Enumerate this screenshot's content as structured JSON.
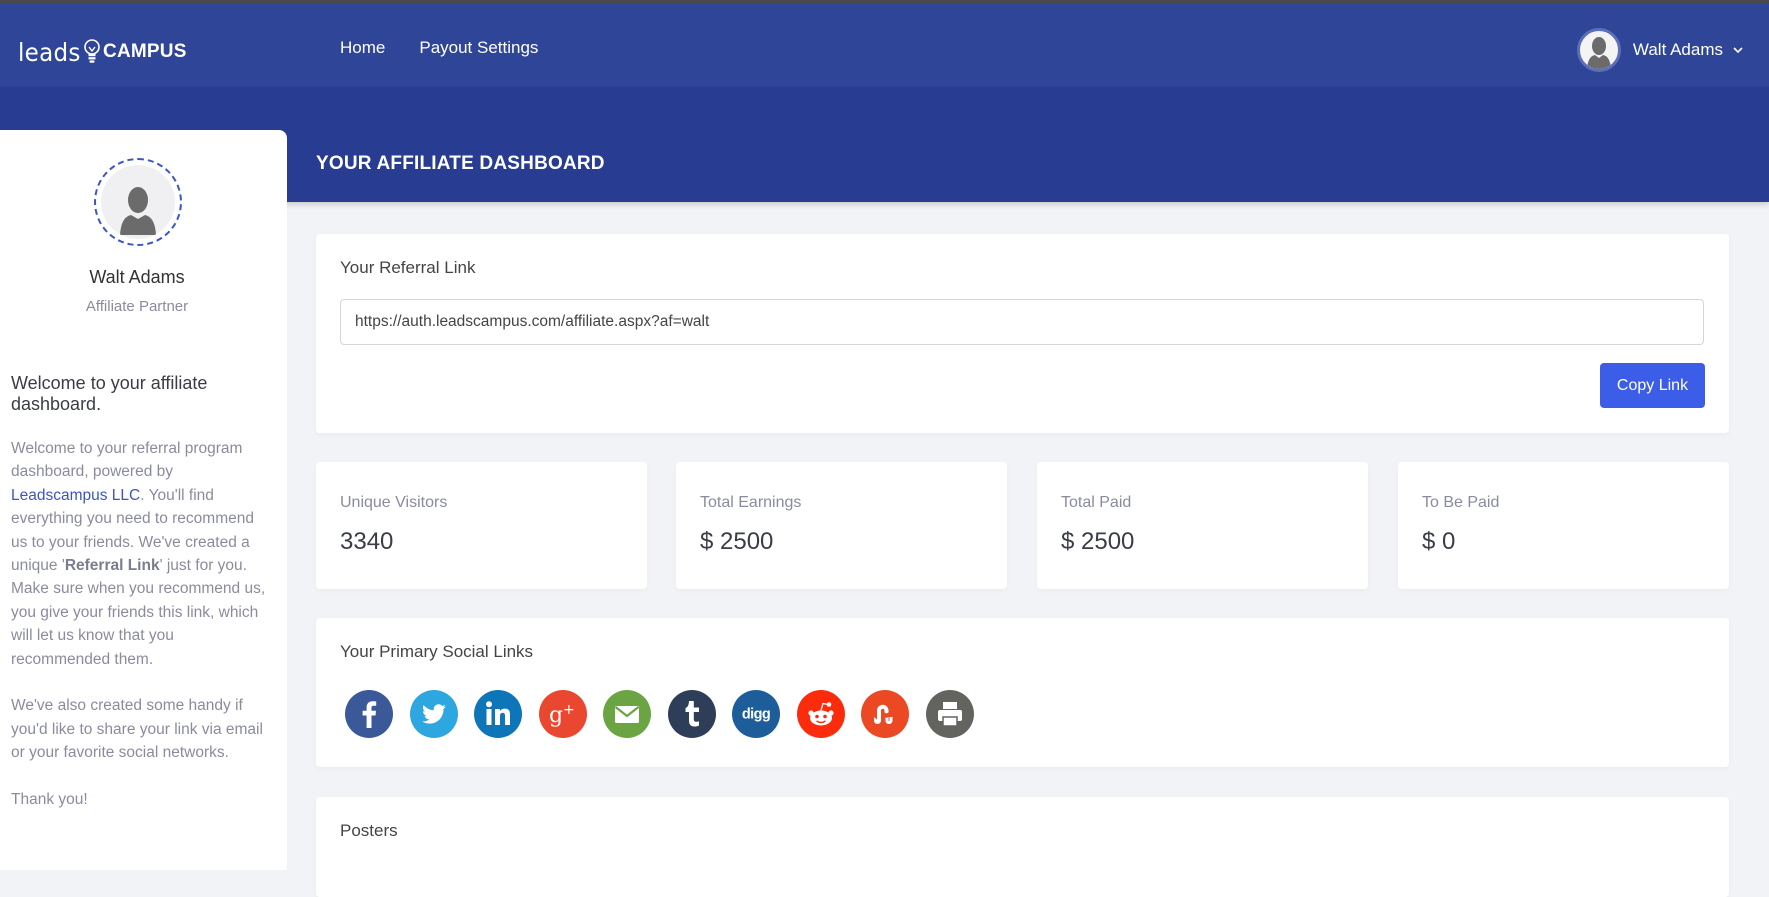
{
  "header": {
    "logo_leads": "leads",
    "logo_campus": "CAMPUS",
    "nav": [
      {
        "label": "Home"
      },
      {
        "label": "Payout Settings"
      }
    ],
    "user_name": "Walt Adams"
  },
  "banner": {
    "title": "YOUR AFFILIATE DASHBOARD"
  },
  "sidebar": {
    "name": "Walt Adams",
    "role": "Affiliate Partner",
    "welcome_heading": "Welcome to your affiliate dashboard.",
    "para1_pre": "Welcome to your referral program dashboard, powered by ",
    "para1_link": "Leadscampus LLC",
    "para1_mid": ". You'll find everything you need to recommend us to your friends. We've created a unique '",
    "para1_bold": "Referral Link",
    "para1_post": "' just for you. Make sure when you recommend us, you give your friends this link, which will let us know that you recommended them.",
    "para2": "We've also created some handy if you'd like to share your link via email or your favorite social networks.",
    "para3": "Thank you!"
  },
  "referral": {
    "title": "Your Referral Link",
    "link": "https://auth.leadscampus.com/affiliate.aspx?af=walt",
    "copy_label": "Copy Link"
  },
  "stats": [
    {
      "label": "Unique Visitors",
      "value": "3340"
    },
    {
      "label": "Total Earnings",
      "value": "$ 2500"
    },
    {
      "label": "Total Paid",
      "value": "$ 2500"
    },
    {
      "label": "To Be Paid",
      "value": "$ 0"
    }
  ],
  "social": {
    "title": "Your Primary Social Links",
    "icons": [
      {
        "name": "facebook",
        "color": "#3b5998"
      },
      {
        "name": "twitter",
        "color": "#2ea7e0"
      },
      {
        "name": "linkedin",
        "color": "#0e76b8"
      },
      {
        "name": "google-plus",
        "color": "#e9472f"
      },
      {
        "name": "email",
        "color": "#6aa443"
      },
      {
        "name": "tumblr",
        "color": "#2e3e58"
      },
      {
        "name": "digg",
        "color": "#1c5d9a"
      },
      {
        "name": "reddit",
        "color": "#fb2c0c"
      },
      {
        "name": "stumbleupon",
        "color": "#eb4924"
      },
      {
        "name": "print",
        "color": "#63635f"
      }
    ]
  },
  "posters": {
    "title": "Posters"
  },
  "colors": {
    "header": "#2f4598",
    "banner": "#283c92",
    "accent": "#3b5de7",
    "link": "#3d55c4"
  }
}
